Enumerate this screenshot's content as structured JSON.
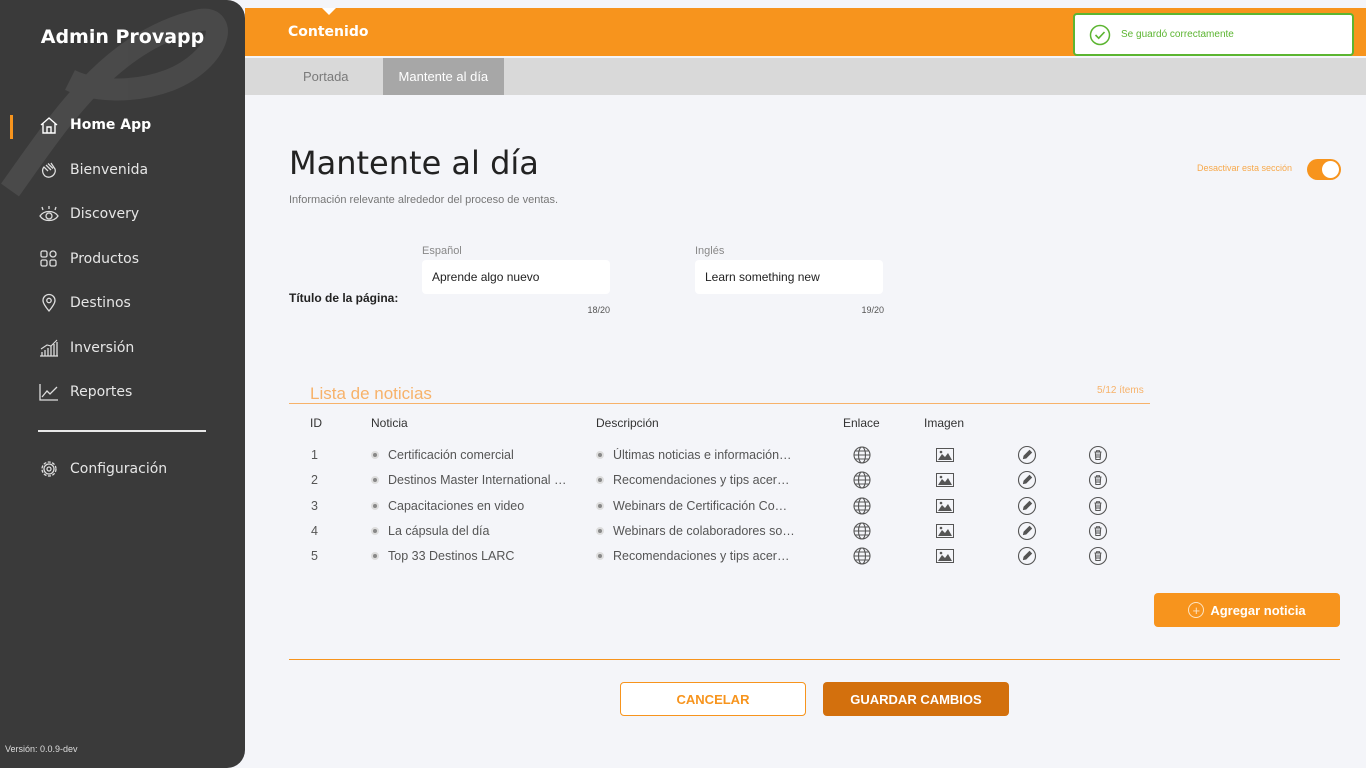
{
  "sidebar": {
    "app_title": "Admin Provapp",
    "items": [
      {
        "label": "Home App",
        "icon": "home-icon"
      },
      {
        "label": "Bienvenida",
        "icon": "wave-hand-icon"
      },
      {
        "label": "Discovery",
        "icon": "eye-icon"
      },
      {
        "label": "Productos",
        "icon": "grid-icon"
      },
      {
        "label": "Destinos",
        "icon": "location-pin-icon"
      },
      {
        "label": "Inversión",
        "icon": "bar-chart-icon"
      },
      {
        "label": "Reportes",
        "icon": "line-chart-icon"
      }
    ],
    "config_label": "Configuración",
    "version": "Versión: 0.0.9-dev"
  },
  "header": {
    "title": "Contenido",
    "toast": "Se guardó correctamente"
  },
  "tabs": [
    {
      "label": "Portada",
      "active": false
    },
    {
      "label": "Mantente al día",
      "active": true
    }
  ],
  "main": {
    "title": "Mantente al día",
    "subtitle": "Información relevante alrededor del proceso de ventas.",
    "toggle_label": "Desactivar esta sección",
    "toggle_on": true,
    "page_title_label": "Título de la página:",
    "spanish": {
      "label": "Español",
      "value": "Aprende algo nuevo",
      "count": "18/20"
    },
    "english": {
      "label": "Inglés",
      "value": "Learn something new",
      "count": "19/20"
    }
  },
  "news": {
    "title": "Lista de noticias",
    "count": "5/12 ítems",
    "headers": {
      "id": "ID",
      "noticia": "Noticia",
      "descripcion": "Descripción",
      "enlace": "Enlace",
      "imagen": "Imagen"
    },
    "rows": [
      {
        "id": "1",
        "noticia": "Certificación comercial",
        "descripcion": "Últimas noticias e información…"
      },
      {
        "id": "2",
        "noticia": "Destinos Master International …",
        "descripcion": "Recomendaciones y tips acer…"
      },
      {
        "id": "3",
        "noticia": "Capacitaciones en video",
        "descripcion": "Webinars de Certificación Co…"
      },
      {
        "id": "4",
        "noticia": "La cápsula del día",
        "descripcion": "Webinars de colaboradores so…"
      },
      {
        "id": "5",
        "noticia": "Top 33 Destinos LARC",
        "descripcion": "Recomendaciones y tips acer…"
      }
    ]
  },
  "actions": {
    "add": "Agregar noticia",
    "cancel": "CANCELAR",
    "save": "GUARDAR CAMBIOS"
  },
  "colors": {
    "accent": "#f7941d",
    "sidebar": "#3a3a3a",
    "success": "#5cb531"
  }
}
